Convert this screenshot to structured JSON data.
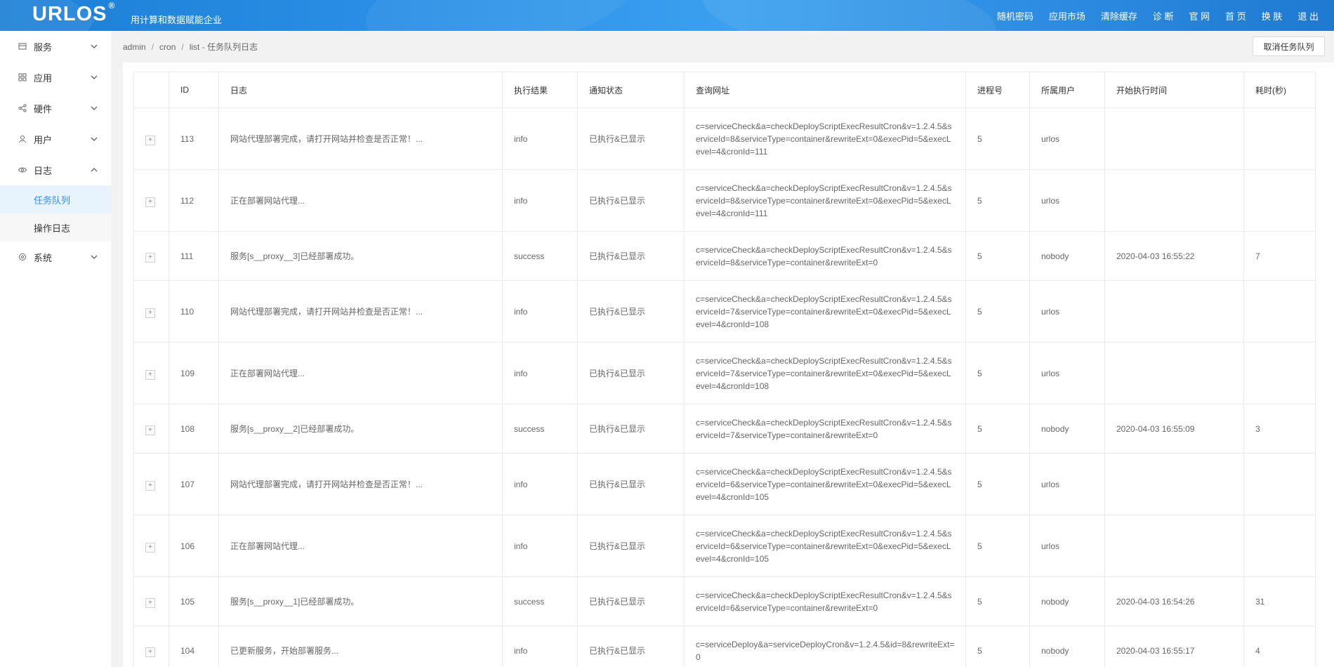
{
  "header": {
    "logo": "URLOS",
    "logo_mark": "®",
    "slogan": "用计算和数据赋能企业",
    "nav": [
      "随机密码",
      "应用市场",
      "清除缓存",
      "诊 断",
      "官 网",
      "首 页",
      "换 肤",
      "退 出"
    ]
  },
  "sidebar": {
    "items": [
      {
        "label": "服务",
        "icon": "store-icon"
      },
      {
        "label": "应用",
        "icon": "grid-icon"
      },
      {
        "label": "硬件",
        "icon": "share-icon"
      },
      {
        "label": "用户",
        "icon": "user-icon"
      },
      {
        "label": "日志",
        "icon": "eye-icon"
      },
      {
        "label": "系统",
        "icon": "gear-icon"
      }
    ],
    "log_sub": [
      "任务队列",
      "操作日志"
    ]
  },
  "breadcrumb": {
    "items": [
      "admin",
      "cron",
      "list"
    ],
    "current": "任务队列日志"
  },
  "toolbar": {
    "cancel_label": "取消任务队列"
  },
  "table": {
    "columns": [
      "",
      "ID",
      "日志",
      "执行结果",
      "通知状态",
      "查询网址",
      "进程号",
      "所属用户",
      "开始执行时间",
      "耗时(秒)"
    ],
    "rows": [
      {
        "id": "113",
        "log": "网站代理部署完成，请打开网站并检查是否正常！...",
        "result": "info",
        "notify": "已执行&已显示",
        "url": "c=serviceCheck&a=checkDeployScriptExecResultCron&v=1.2.4.5&serviceId=8&serviceType=container&rewriteExt=0&execPid=5&execLevel=4&cronId=111",
        "pid": "5",
        "user": "urlos",
        "start": "",
        "cost": ""
      },
      {
        "id": "112",
        "log": "正在部署网站代理...",
        "result": "info",
        "notify": "已执行&已显示",
        "url": "c=serviceCheck&a=checkDeployScriptExecResultCron&v=1.2.4.5&serviceId=8&serviceType=container&rewriteExt=0&execPid=5&execLevel=4&cronId=111",
        "pid": "5",
        "user": "urlos",
        "start": "",
        "cost": ""
      },
      {
        "id": "111",
        "log": "服务[s__proxy__3]已经部署成功。",
        "result": "success",
        "notify": "已执行&已显示",
        "url": "c=serviceCheck&a=checkDeployScriptExecResultCron&v=1.2.4.5&serviceId=8&serviceType=container&rewriteExt=0",
        "pid": "5",
        "user": "nobody",
        "start": "2020-04-03 16:55:22",
        "cost": "7"
      },
      {
        "id": "110",
        "log": "网站代理部署完成，请打开网站并检查是否正常！...",
        "result": "info",
        "notify": "已执行&已显示",
        "url": "c=serviceCheck&a=checkDeployScriptExecResultCron&v=1.2.4.5&serviceId=7&serviceType=container&rewriteExt=0&execPid=5&execLevel=4&cronId=108",
        "pid": "5",
        "user": "urlos",
        "start": "",
        "cost": ""
      },
      {
        "id": "109",
        "log": "正在部署网站代理...",
        "result": "info",
        "notify": "已执行&已显示",
        "url": "c=serviceCheck&a=checkDeployScriptExecResultCron&v=1.2.4.5&serviceId=7&serviceType=container&rewriteExt=0&execPid=5&execLevel=4&cronId=108",
        "pid": "5",
        "user": "urlos",
        "start": "",
        "cost": ""
      },
      {
        "id": "108",
        "log": "服务[s__proxy__2]已经部署成功。",
        "result": "success",
        "notify": "已执行&已显示",
        "url": "c=serviceCheck&a=checkDeployScriptExecResultCron&v=1.2.4.5&serviceId=7&serviceType=container&rewriteExt=0",
        "pid": "5",
        "user": "nobody",
        "start": "2020-04-03 16:55:09",
        "cost": "3"
      },
      {
        "id": "107",
        "log": "网站代理部署完成，请打开网站并检查是否正常！...",
        "result": "info",
        "notify": "已执行&已显示",
        "url": "c=serviceCheck&a=checkDeployScriptExecResultCron&v=1.2.4.5&serviceId=6&serviceType=container&rewriteExt=0&execPid=5&execLevel=4&cronId=105",
        "pid": "5",
        "user": "urlos",
        "start": "",
        "cost": ""
      },
      {
        "id": "106",
        "log": "正在部署网站代理...",
        "result": "info",
        "notify": "已执行&已显示",
        "url": "c=serviceCheck&a=checkDeployScriptExecResultCron&v=1.2.4.5&serviceId=6&serviceType=container&rewriteExt=0&execPid=5&execLevel=4&cronId=105",
        "pid": "5",
        "user": "urlos",
        "start": "",
        "cost": ""
      },
      {
        "id": "105",
        "log": "服务[s__proxy__1]已经部署成功。",
        "result": "success",
        "notify": "已执行&已显示",
        "url": "c=serviceCheck&a=checkDeployScriptExecResultCron&v=1.2.4.5&serviceId=6&serviceType=container&rewriteExt=0",
        "pid": "5",
        "user": "nobody",
        "start": "2020-04-03 16:54:26",
        "cost": "31"
      },
      {
        "id": "104",
        "log": "已更新服务，开始部署服务...",
        "result": "info",
        "notify": "已执行&已显示",
        "url": "c=serviceDeploy&a=serviceDeployCron&v=1.2.4.5&id=8&rewriteExt=0",
        "pid": "5",
        "user": "nobody",
        "start": "2020-04-03 16:55:17",
        "cost": "4"
      }
    ]
  },
  "colors": {
    "brand": "#2a8fe6",
    "active_text": "#2d8cf0",
    "active_bg": "#e8f4fd"
  }
}
